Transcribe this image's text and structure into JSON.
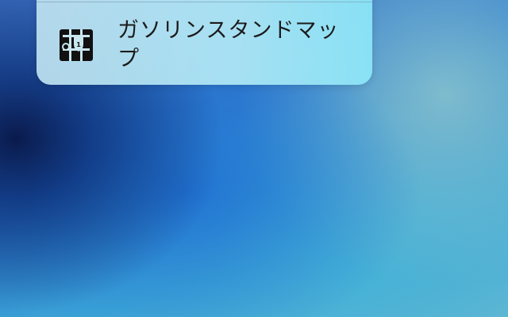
{
  "quick_actions": {
    "items": [
      {
        "label": "ガソリンスタンドマップ",
        "icon": "gas-station-map-icon"
      }
    ]
  },
  "colors": {
    "panel_start": "#bee1f0",
    "panel_end": "#8ce6f8",
    "text": "#1b1b1b"
  }
}
